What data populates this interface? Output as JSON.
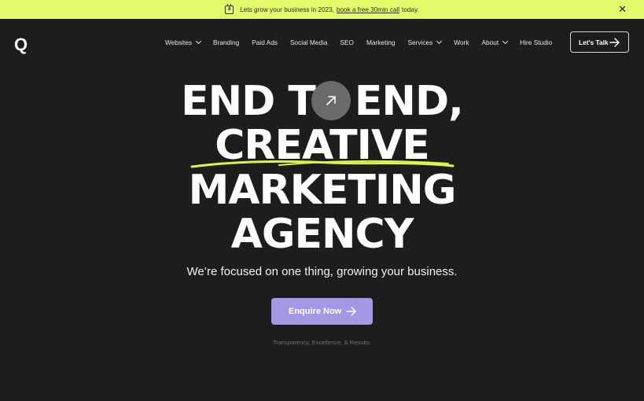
{
  "banner": {
    "text_before": "Lets grow your business in 2023,",
    "link": "book a free 30min call",
    "text_after": "today.",
    "close": "✕"
  },
  "nav": {
    "logo": "Q",
    "items": [
      {
        "label": "Websites",
        "dropdown": true
      },
      {
        "label": "Branding",
        "dropdown": false
      },
      {
        "label": "Paid Ads",
        "dropdown": false
      },
      {
        "label": "Social Media",
        "dropdown": false
      },
      {
        "label": "SEO",
        "dropdown": false
      },
      {
        "label": "Marketing",
        "dropdown": false
      },
      {
        "label": "Services",
        "dropdown": true
      },
      {
        "label": "Work",
        "dropdown": false
      },
      {
        "label": "About",
        "dropdown": true
      },
      {
        "label": "Hire Studio",
        "dropdown": false
      }
    ],
    "cta": "Let's Talk"
  },
  "hero": {
    "line1_a": "END T",
    "line1_b": "END,",
    "line2": "CREATIVE",
    "line3": "MARKETING",
    "line4": "AGENCY",
    "tagline": "We’re focused on one thing, growing your business.",
    "cta": "Enquire Now",
    "footnote": "Transparency, Excellence, & Results."
  },
  "colors": {
    "banner": "#e3fb6b",
    "background": "#1e1d1e",
    "accent": "#a596e6",
    "squiggle": "#d8f74a"
  }
}
